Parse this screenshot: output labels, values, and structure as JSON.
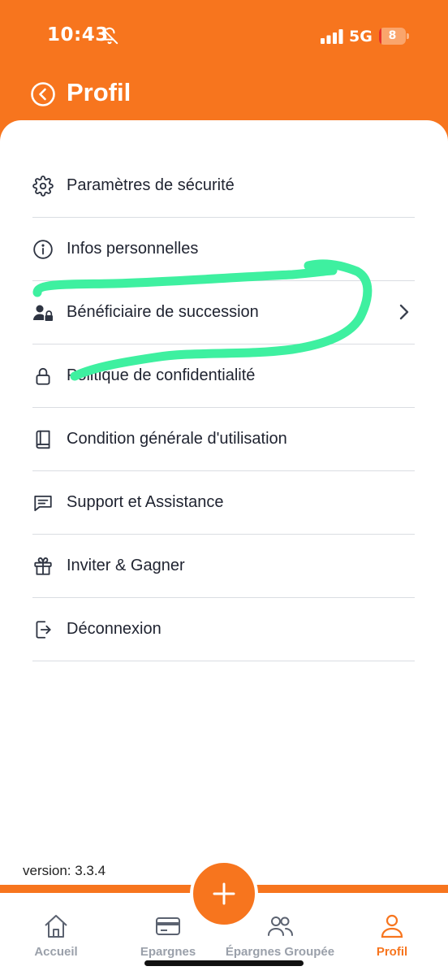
{
  "status_bar": {
    "time": "10:43",
    "network": "5G",
    "battery_level": "8",
    "battery_fraction": 0.08
  },
  "header": {
    "title": "Profil",
    "back_icon": "back-arrow-circle-icon"
  },
  "menu": [
    {
      "label": "Paramètres de sécurité",
      "icon": "gear-icon"
    },
    {
      "label": "Infos personnelles",
      "icon": "info-circle-icon"
    },
    {
      "label": "Bénéficiaire de succession",
      "icon": "user-lock-icon",
      "chevron": true
    },
    {
      "label": "Politique de confidentialité",
      "icon": "lock-icon"
    },
    {
      "label": "Condition générale d'utilisation",
      "icon": "book-icon"
    },
    {
      "label": "Support et Assistance",
      "icon": "chat-icon"
    },
    {
      "label": "Inviter & Gagner",
      "icon": "gift-icon"
    },
    {
      "label": "Déconnexion",
      "icon": "logout-icon"
    }
  ],
  "version": "version: 3.3.4",
  "tabs": [
    {
      "label": "Accueil",
      "icon": "home-icon"
    },
    {
      "label": "Epargnes",
      "icon": "card-icon"
    },
    {
      "label": "Épargnes Groupée",
      "icon": "users-icon"
    },
    {
      "label": "Profil",
      "icon": "user-icon",
      "active": true
    }
  ],
  "colors": {
    "accent": "#F7751E",
    "scribble": "#3EF0A0",
    "text": "#1F2330",
    "tab_inactive": "#9AA0AA"
  }
}
